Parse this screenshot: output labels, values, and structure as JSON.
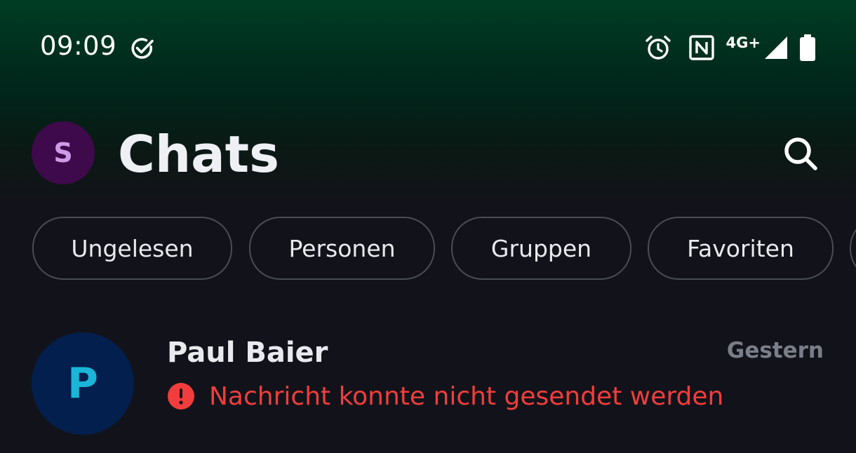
{
  "status_bar": {
    "time": "09:09",
    "network": "4G+",
    "icons": [
      "check-circle-icon",
      "alarm-icon",
      "nfc-icon",
      "signal-icon",
      "battery-icon"
    ]
  },
  "header": {
    "profile_initial": "S",
    "title": "Chats",
    "search_icon": "search-icon"
  },
  "filters": [
    {
      "label": "Ungelesen"
    },
    {
      "label": "Personen"
    },
    {
      "label": "Gruppen"
    },
    {
      "label": "Favoriten"
    }
  ],
  "chats": [
    {
      "initial": "P",
      "name": "Paul Baier",
      "time": "Gestern",
      "preview": "Nachricht konnte nicht gesendet werden",
      "status": "error"
    }
  ],
  "colors": {
    "background": "#12131a",
    "header_gradient_top": "#003d24",
    "profile_avatar_bg": "#3e0a4b",
    "profile_avatar_fg": "#cf9be6",
    "chat_avatar_bg": "#031f4d",
    "chat_avatar_fg": "#1bb5d8",
    "error": "#f23d3d",
    "muted": "#7a7e88"
  }
}
